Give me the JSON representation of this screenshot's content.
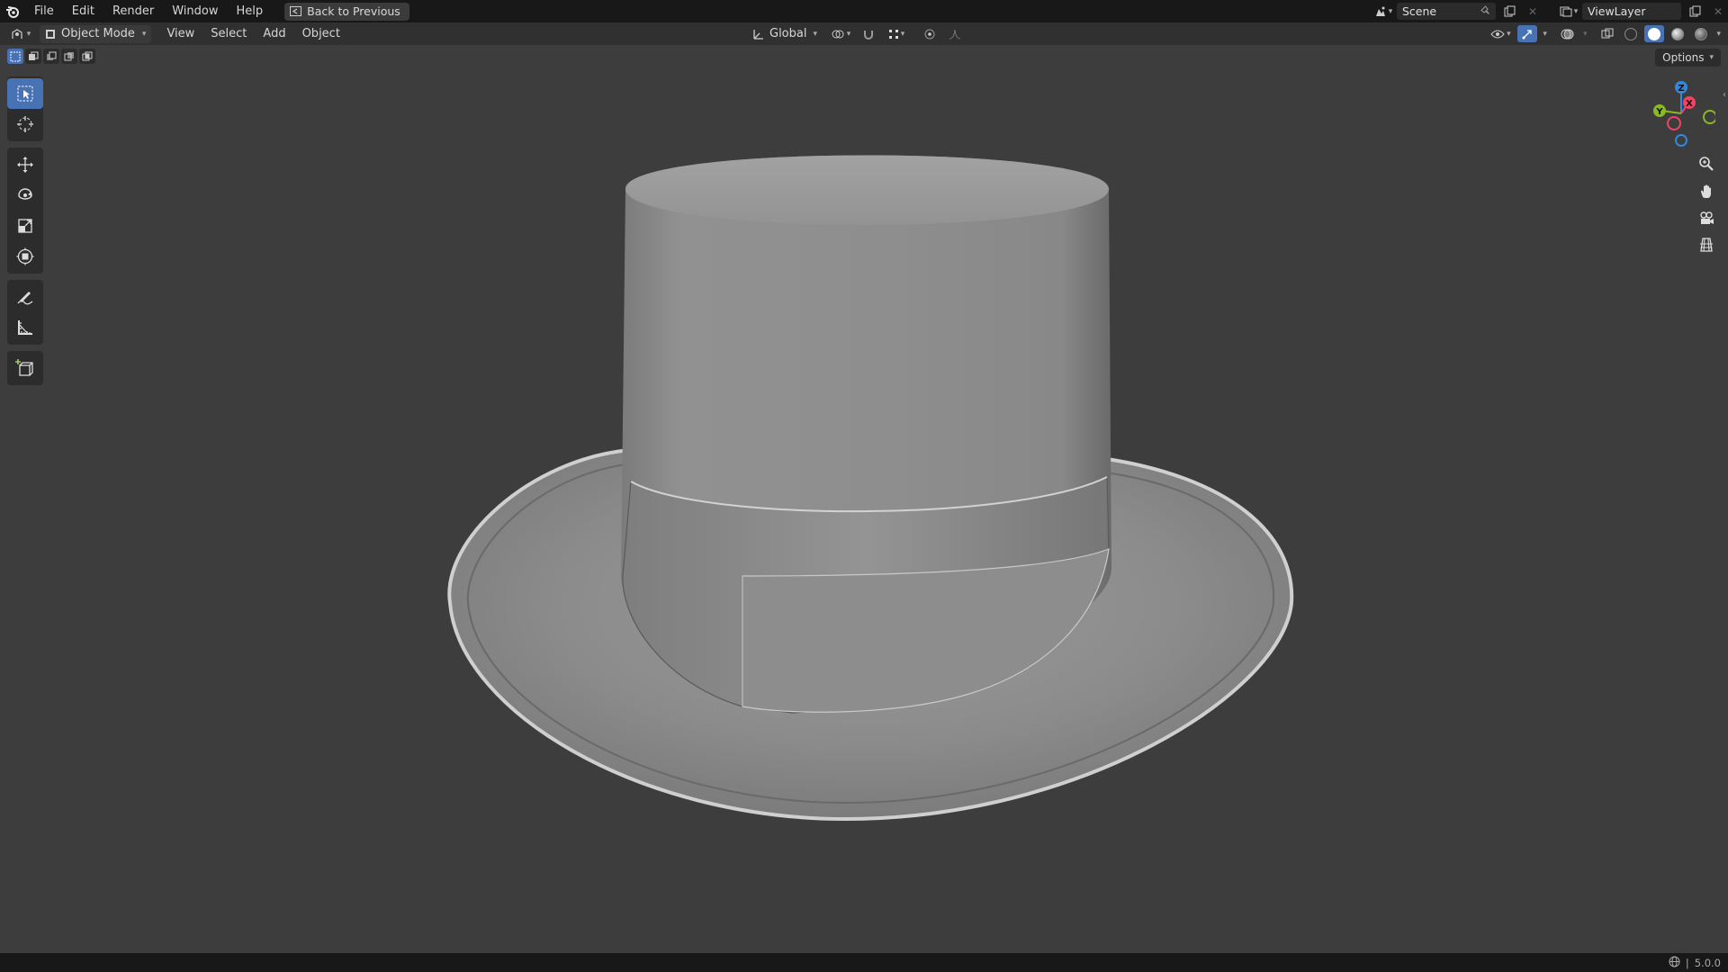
{
  "menu": {
    "items": [
      "File",
      "Edit",
      "Render",
      "Window",
      "Help"
    ],
    "back_label": "Back to Previous"
  },
  "scene": {
    "name": "Scene"
  },
  "view_layer": {
    "name": "ViewLayer"
  },
  "header": {
    "mode_label": "Object Mode",
    "menus": [
      "View",
      "Select",
      "Add",
      "Object"
    ],
    "transform_orientation": "Global"
  },
  "options_label": "Options",
  "gizmo": {
    "x_label": "X",
    "y_label": "Y",
    "z_label": "Z",
    "x_color": "#ee4466",
    "y_color": "#88bb22",
    "z_color": "#3388dd"
  },
  "status": {
    "version": "5.0.0"
  },
  "colors": {
    "accent": "#4772b3",
    "viewport": "#3d3d3d"
  }
}
